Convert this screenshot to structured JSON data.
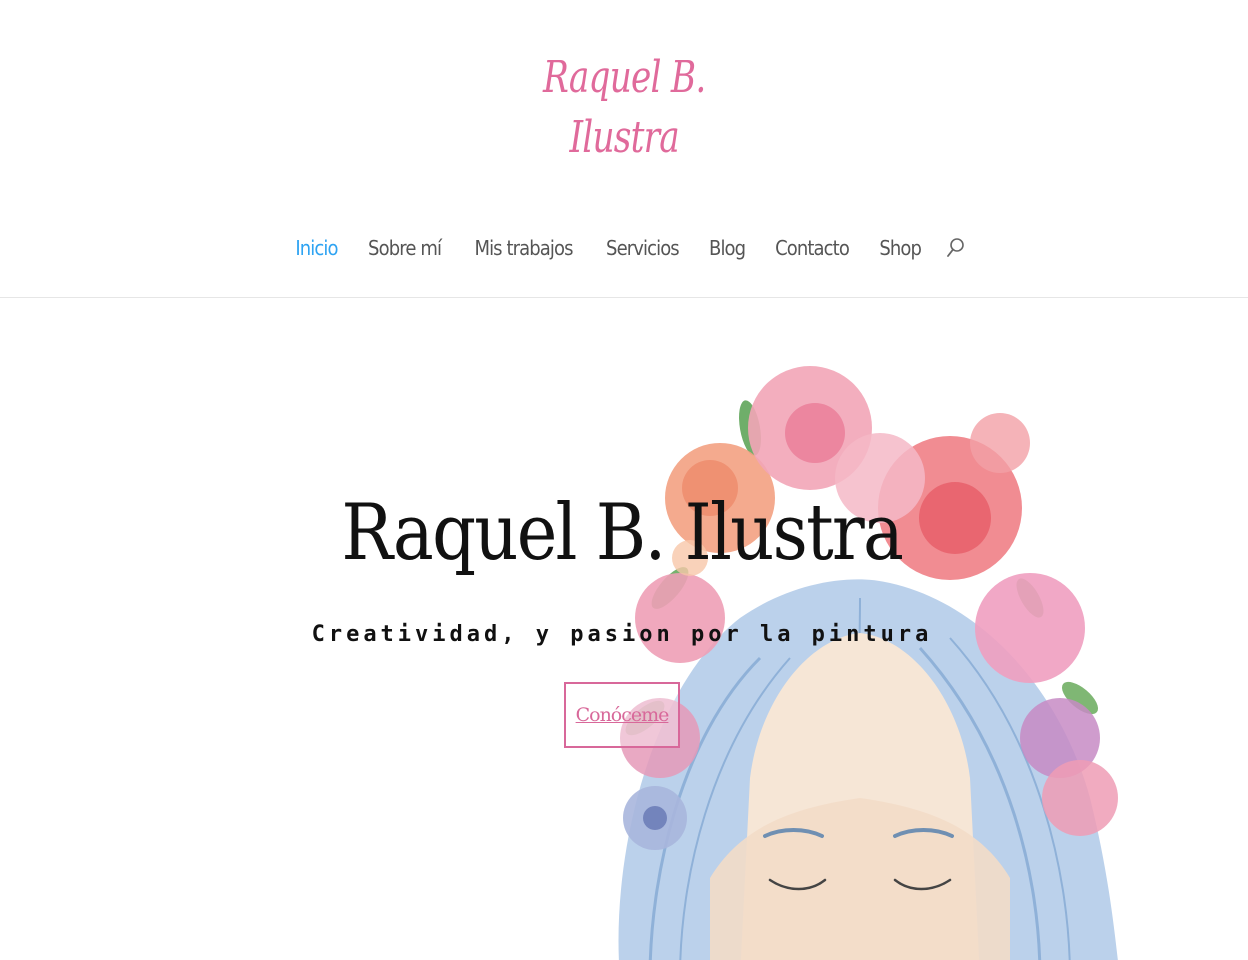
{
  "header": {
    "logo_line1": "Raquel B.",
    "logo_line2": "Ilustra",
    "nav": [
      {
        "label": "Inicio"
      },
      {
        "label": "Sobre mí"
      },
      {
        "label": "Mis trabajos"
      },
      {
        "label": "Servicios"
      },
      {
        "label": "Blog"
      },
      {
        "label": "Contacto"
      },
      {
        "label": "Shop"
      }
    ],
    "search_icon": "search-icon"
  },
  "hero": {
    "title": "Raquel B. Ilustra",
    "subtitle": "Creatividad, y pasion por la pintura",
    "button_label": "Conóceme",
    "illustration": "watercolor girl with blue hair and flower crown"
  },
  "colors": {
    "brand_pink": "#e06a9b",
    "nav_active": "#2ea3f2",
    "nav_text": "#555555",
    "hair_blue": "#a9c7e6",
    "text_dark": "#111111"
  }
}
